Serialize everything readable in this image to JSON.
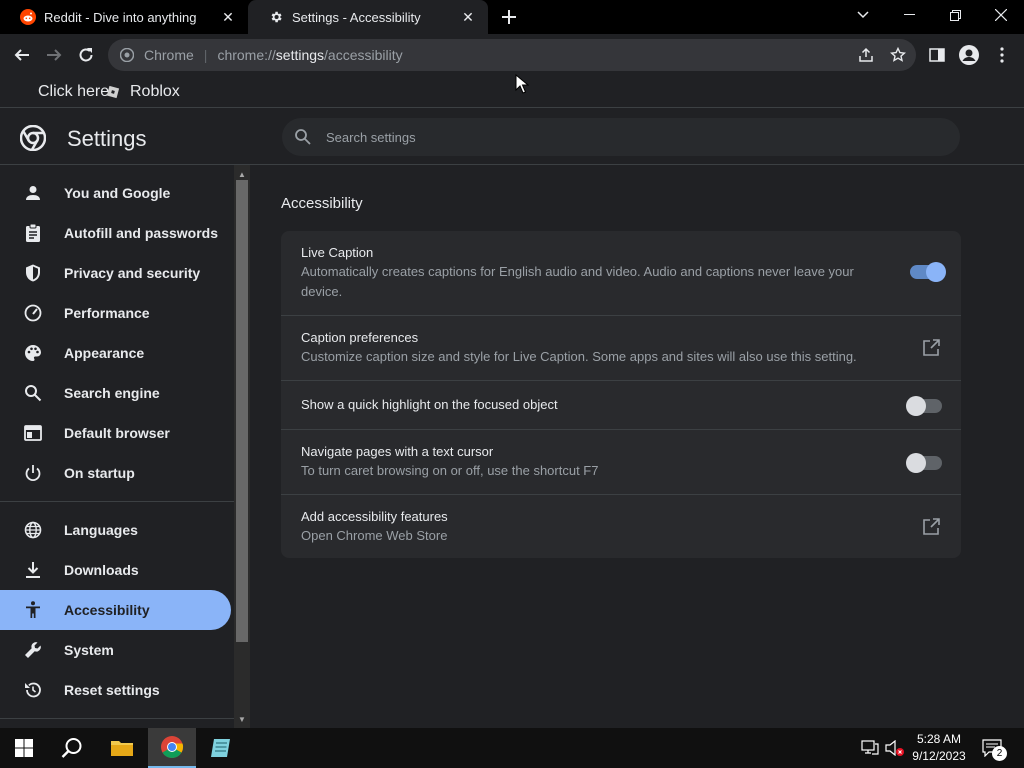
{
  "tabs": [
    {
      "title": "Reddit - Dive into anything",
      "close": "✕"
    },
    {
      "title": "Settings - Accessibility",
      "close": "✕"
    }
  ],
  "omnibox": {
    "chip": "Chrome",
    "separator": "|",
    "url_scheme": "chrome://",
    "url_host": "settings",
    "url_path": "/accessibility"
  },
  "bookmarks": [
    {
      "label": "Click here"
    },
    {
      "label": "Roblox"
    }
  ],
  "settings": {
    "title": "Settings",
    "search_placeholder": "Search settings"
  },
  "sidebar": {
    "items": [
      {
        "label": "You and Google",
        "icon": "person-icon"
      },
      {
        "label": "Autofill and passwords",
        "icon": "clipboard-icon"
      },
      {
        "label": "Privacy and security",
        "icon": "shield-icon"
      },
      {
        "label": "Performance",
        "icon": "speedometer-icon"
      },
      {
        "label": "Appearance",
        "icon": "palette-icon"
      },
      {
        "label": "Search engine",
        "icon": "search-icon"
      },
      {
        "label": "Default browser",
        "icon": "browser-icon"
      },
      {
        "label": "On startup",
        "icon": "power-icon"
      },
      {
        "label": "Languages",
        "icon": "globe-icon"
      },
      {
        "label": "Downloads",
        "icon": "download-icon"
      },
      {
        "label": "Accessibility",
        "icon": "accessibility-icon",
        "active": true
      },
      {
        "label": "System",
        "icon": "wrench-icon"
      },
      {
        "label": "Reset settings",
        "icon": "reset-icon"
      }
    ]
  },
  "main": {
    "section_title": "Accessibility",
    "rows": [
      {
        "label": "Live Caption",
        "sub": "Automatically creates captions for English audio and video. Audio and captions never leave your device.",
        "control": "toggle",
        "state": "on"
      },
      {
        "label": "Caption preferences",
        "sub": "Customize caption size and style for Live Caption. Some apps and sites will also use this setting.",
        "control": "external-link"
      },
      {
        "label": "Show a quick highlight on the focused object",
        "control": "toggle",
        "state": "off"
      },
      {
        "label": "Navigate pages with a text cursor",
        "sub": "To turn caret browsing on or off, use the shortcut F7",
        "control": "toggle",
        "state": "off"
      },
      {
        "label": "Add accessibility features",
        "sub": "Open Chrome Web Store",
        "control": "external-link"
      }
    ]
  },
  "taskbar": {
    "time": "5:28 AM",
    "date": "9/12/2023",
    "notification_count": "2"
  },
  "colors": {
    "accent": "#8ab4f8",
    "background": "#202124",
    "card": "#292a2d"
  }
}
